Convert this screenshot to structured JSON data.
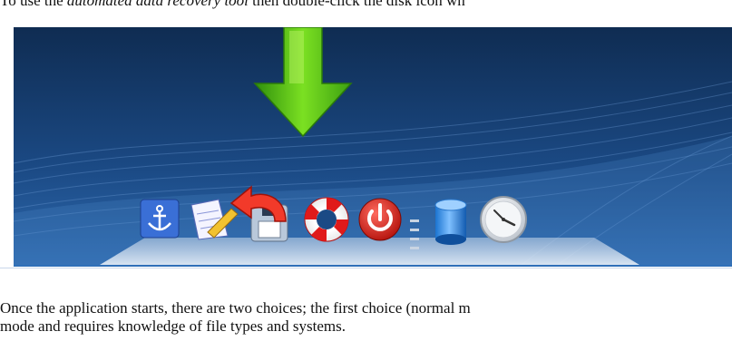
{
  "intro": {
    "text_before": "To use the ",
    "text_italic": "automated data recovery tool",
    "text_after": " then double-click the disk icon wh"
  },
  "desktop": {
    "background_color": "#14355f",
    "arrow_color": "#58c418",
    "dock_items": [
      {
        "icon": "anchor-icon",
        "label": ""
      },
      {
        "icon": "notepad-pencil-icon",
        "label": ""
      },
      {
        "icon": "disk-restore-icon",
        "label": ""
      },
      {
        "icon": "life-ring-icon",
        "label": ""
      },
      {
        "icon": "power-icon",
        "label": ""
      },
      {
        "icon": "cylinder-icon",
        "label": ""
      },
      {
        "icon": "clock-icon",
        "label": ""
      }
    ]
  },
  "paragraph": {
    "line1": "Once the application starts, there are two choices; the first choice (normal m",
    "line2": "mode and requires knowledge of file types and systems."
  }
}
